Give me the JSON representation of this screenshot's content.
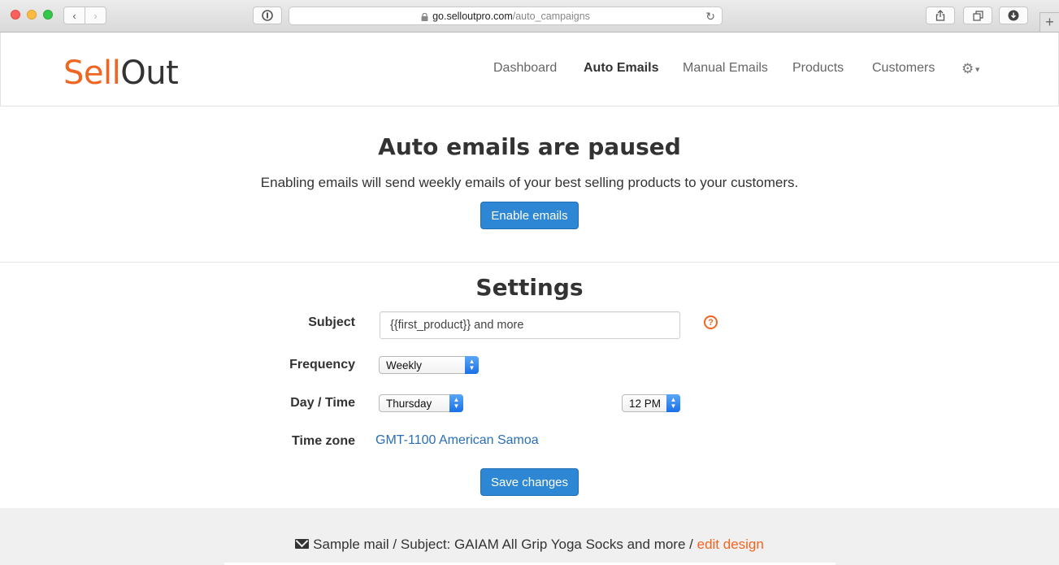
{
  "browser": {
    "url_host": "go.selloutpro.com",
    "url_path": "/auto_campaigns",
    "icons": [
      "back-icon",
      "forward-icon",
      "reader-icon",
      "lock-icon",
      "reload-icon",
      "share-icon",
      "tabs-icon",
      "download-icon",
      "new-tab-icon"
    ]
  },
  "nav": {
    "logo_left": "Sell",
    "logo_right": "Out",
    "items": [
      {
        "label": "Dashboard",
        "active": false
      },
      {
        "label": "Auto Emails",
        "active": true
      },
      {
        "label": "Manual Emails",
        "active": false
      },
      {
        "label": "Products",
        "active": false
      },
      {
        "label": "Customers",
        "active": false
      }
    ],
    "settings_icon": "gear-icon"
  },
  "paused": {
    "title": "Auto emails are paused",
    "description": "Enabling emails will send weekly emails of your best selling products to your customers.",
    "button": "Enable emails"
  },
  "settings": {
    "title": "Settings",
    "subject_label": "Subject",
    "subject_value": "{{first_product}} and more",
    "help_icon": "?",
    "frequency_label": "Frequency",
    "frequency_value": "Weekly",
    "daytime_label": "Day / Time",
    "day_value": "Thursday",
    "time_value": "12 PM",
    "timezone_label": "Time zone",
    "timezone_value": "GMT-1100 American Samoa",
    "save_button": "Save changes"
  },
  "preview": {
    "text": "Sample mail / Subject: GAIAM All Grip Yoga Socks and more / ",
    "edit_link": "edit design"
  },
  "colors": {
    "brand_orange": "#f16522",
    "primary_blue": "#2d87d4",
    "link_blue": "#2a6fb5"
  }
}
